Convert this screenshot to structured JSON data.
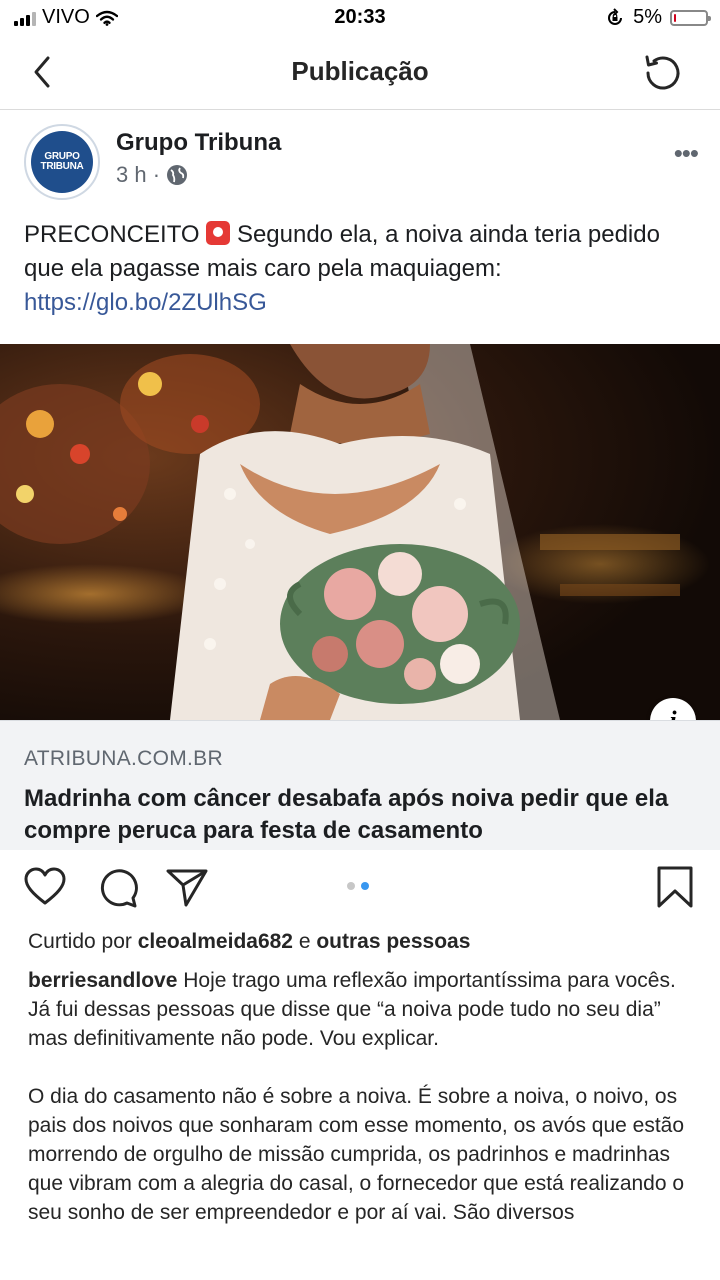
{
  "status_bar": {
    "carrier": "VIVO",
    "time": "20:33",
    "battery": "5%",
    "battery_level": 0.05,
    "icons": [
      "signal-icon",
      "wifi-icon",
      "lock-rotation-icon",
      "battery-icon"
    ]
  },
  "nav": {
    "title": "Publicação",
    "icons": [
      "back-chevron-icon",
      "refresh-icon"
    ]
  },
  "post_image": {
    "page_name": "Grupo Tribuna",
    "avatar_text_line1": "GRUPO",
    "avatar_text_line2": "TRIBUNA",
    "time_ago": "3 h ·",
    "more": "•••",
    "text_label": "PRECONCEITO",
    "text_body": " Segundo ela, a noiva ainda teria pedido que ela pagasse mais caro pela maquiagem: ",
    "link": "https://glo.bo/2ZUlhSG",
    "info": "i",
    "preview_domain": "ATRIBUNA.COM.BR",
    "preview_title": "Madrinha com câncer desabafa após noiva pedir que ela compre peruca para festa de casamento"
  },
  "actions": {
    "icons": [
      "heart-icon",
      "comment-icon",
      "share-icon",
      "bookmark-icon"
    ],
    "carousel_count": 2,
    "carousel_active": 2
  },
  "likes": {
    "prefix": "Curtido por ",
    "user": "cleoalmeida682",
    "middle": " e ",
    "others": "outras pessoas"
  },
  "caption": {
    "username": "berriesandlove",
    "paragraph1": " Hoje trago uma reflexão importantíssima para vocês. Já fui dessas pessoas que disse que “a noiva pode tudo no seu dia” mas definitivamente não pode. Vou explicar.",
    "paragraph2": "O dia do casamento não é sobre a noiva. É sobre a noiva, o noivo, os pais dos noivos que sonharam com esse momento, os avós que estão morrendo de orgulho de missão cumprida, os padrinhos e madrinhas que vibram com a alegria do casal, o fornecedor que está realizando o seu sonho de ser empreendedor e por aí vai. São diversos"
  },
  "colors": {
    "link": "#385898",
    "accent": "#3897f0",
    "text": "#262626",
    "battery_low": "#d0021b"
  }
}
